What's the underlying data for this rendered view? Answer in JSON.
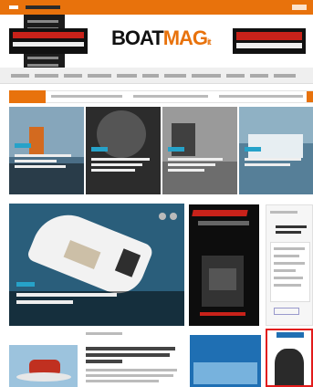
{
  "brand": {
    "logo_main": "BOAT",
    "logo_accent": "MAG",
    "logo_suffix": "it"
  },
  "colors": {
    "accent": "#e8720c",
    "tag": "#26a2c9",
    "ad_red": "#c8221a"
  },
  "icons": [
    "social-icons",
    "dropdown-menu",
    "search-icon"
  ],
  "promo": {
    "salone_title": "",
    "salone_subtitle": ""
  }
}
